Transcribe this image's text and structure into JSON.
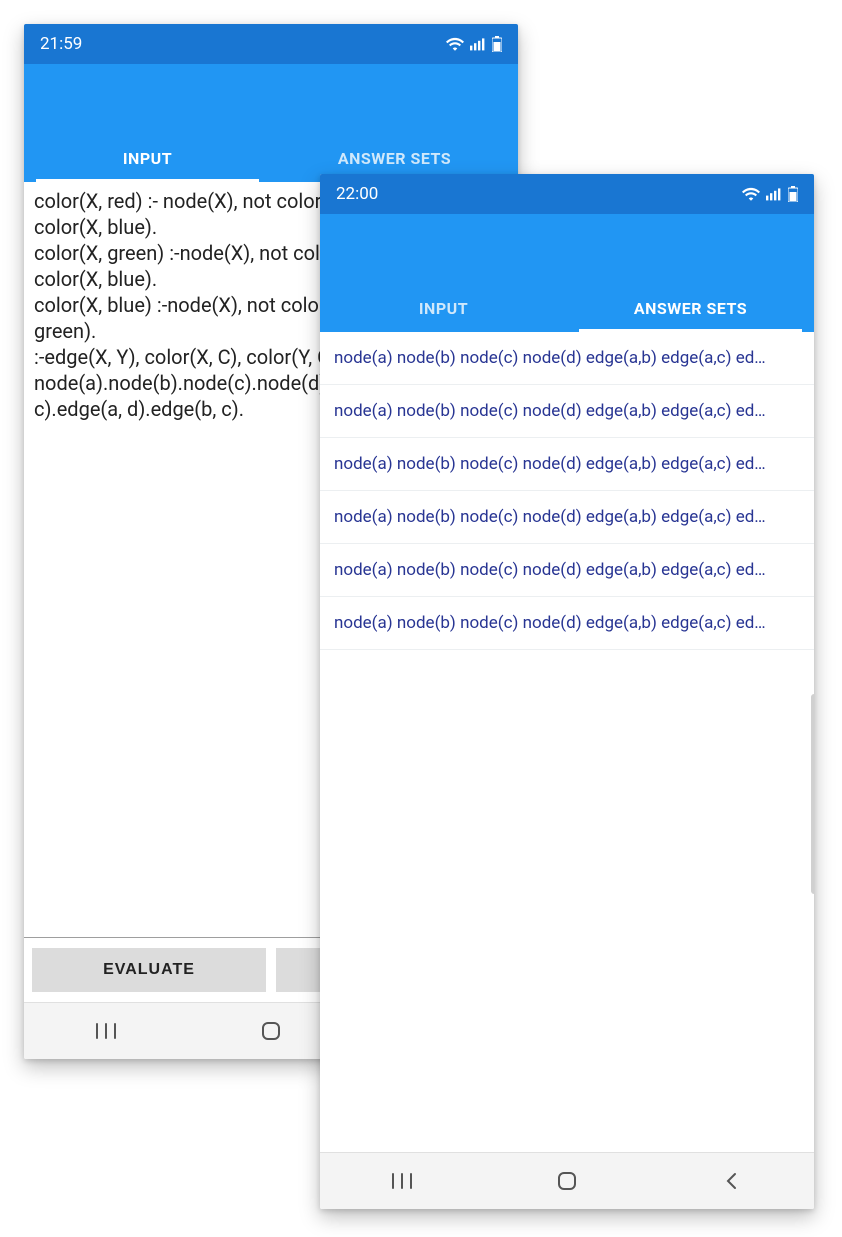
{
  "back": {
    "status_time": "21:59",
    "tabs": {
      "input": "INPUT",
      "answer_sets": "ANSWER SETS"
    },
    "active_tab": "input",
    "code_text": "color(X, red) :- node(X), not color(X, green), not color(X, blue).\ncolor(X, green) :-node(X), not color(X, red), not color(X, blue).\ncolor(X, blue) :-node(X), not color(X, red), not color(X, green).\n:-edge(X, Y), color(X, C), color(Y, C).\nnode(a).node(b).node(c).node(d).edge(a, b).edge(a, c).edge(a, d).edge(b, c).",
    "buttons": {
      "evaluate": "EVALUATE",
      "second": ""
    }
  },
  "front": {
    "status_time": "22:00",
    "tabs": {
      "input": "INPUT",
      "answer_sets": "ANSWER SETS"
    },
    "active_tab": "answer_sets",
    "answers": [
      "node(a) node(b) node(c) node(d) edge(a,b) edge(a,c) ed…",
      "node(a) node(b) node(c) node(d) edge(a,b) edge(a,c) ed…",
      "node(a) node(b) node(c) node(d) edge(a,b) edge(a,c) ed…",
      "node(a) node(b) node(c) node(d) edge(a,b) edge(a,c) ed…",
      "node(a) node(b) node(c) node(d) edge(a,b) edge(a,c) ed…",
      "node(a) node(b) node(c) node(d) edge(a,b) edge(a,c) ed…"
    ]
  }
}
